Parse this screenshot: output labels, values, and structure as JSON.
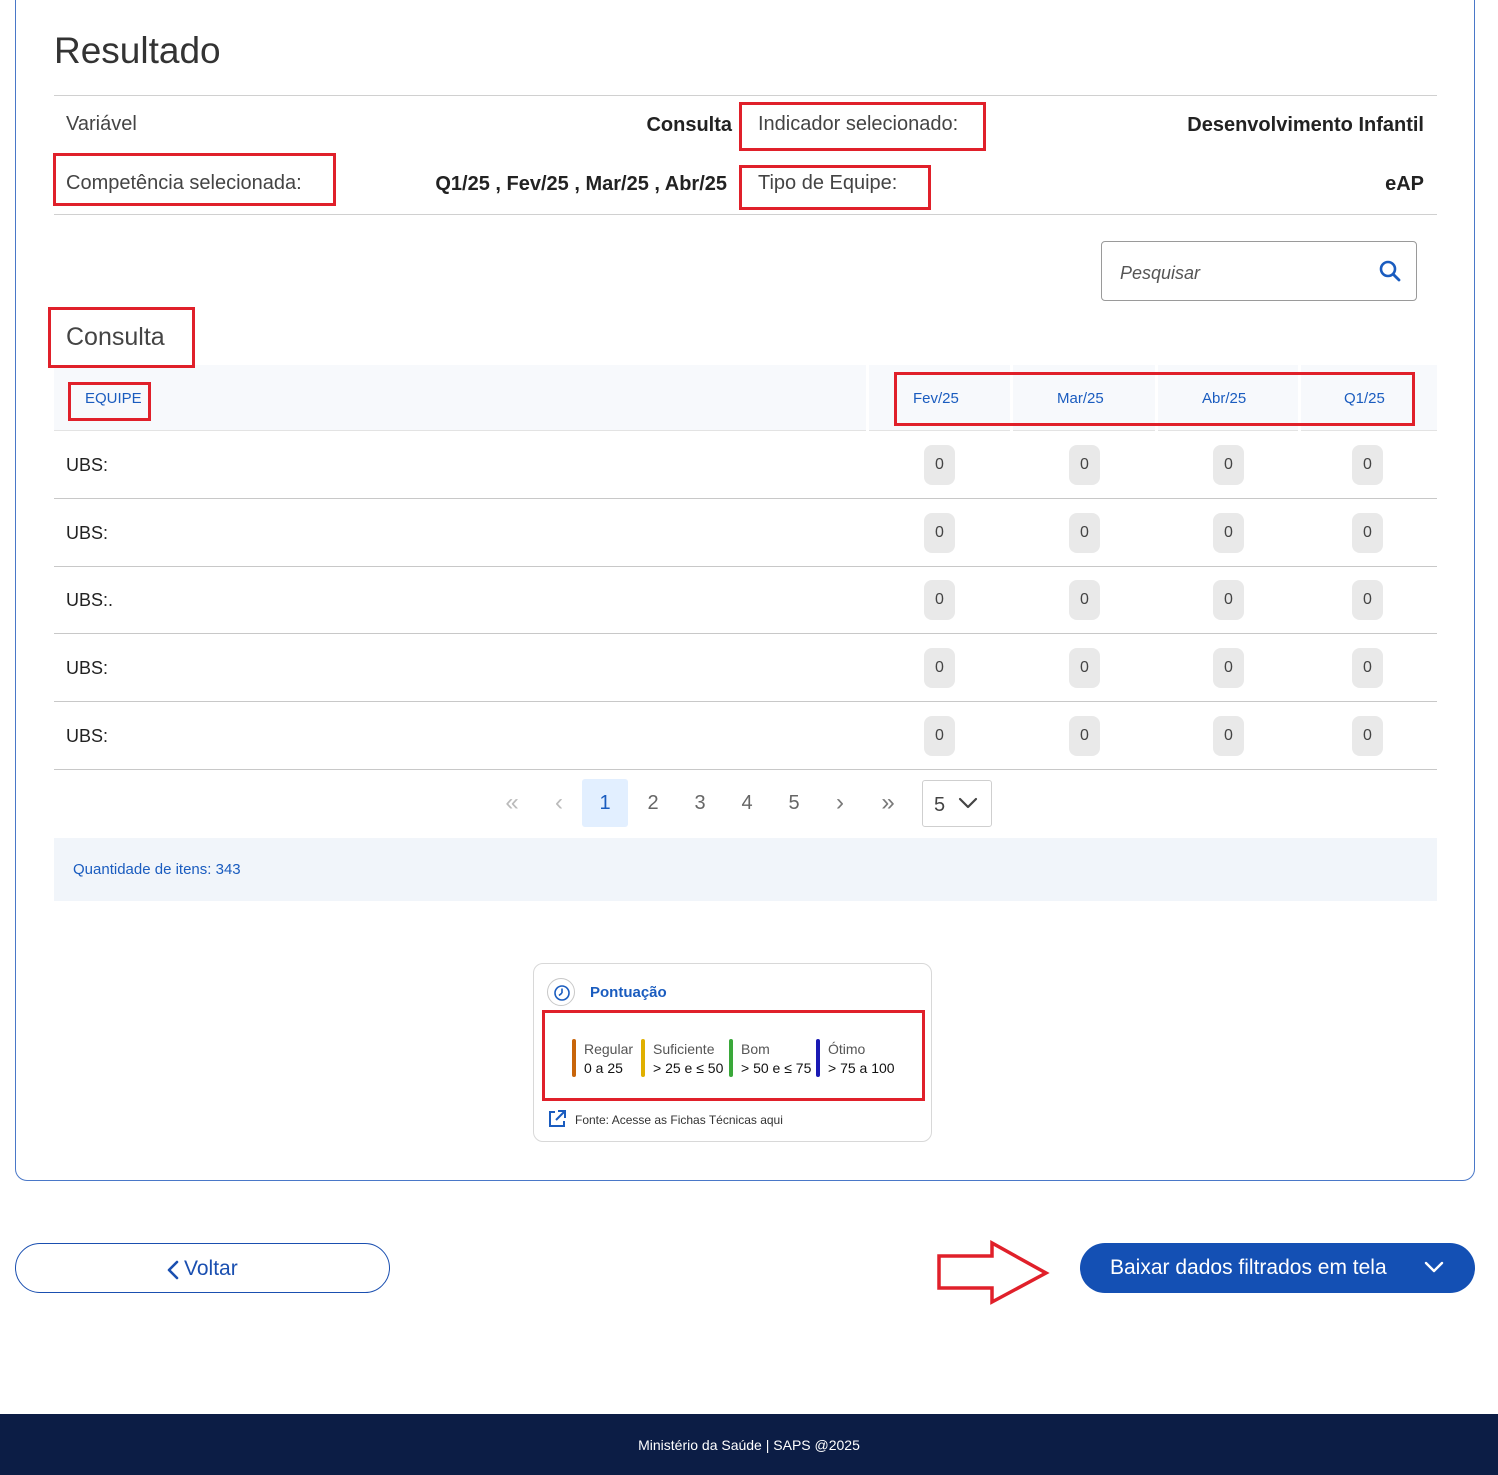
{
  "page": {
    "title": "Resultado"
  },
  "info": {
    "variavel_label": "Variável",
    "variavel_value": "Consulta",
    "indicador_label": "Indicador selecionado:",
    "indicador_value": "Desenvolvimento Infantil",
    "competencia_label": "Competência selecionada:",
    "competencia_value": "Q1/25 , Fev/25 , Mar/25 , Abr/25",
    "tipo_label": "Tipo de Equipe:",
    "tipo_value": "eAP"
  },
  "search": {
    "placeholder": "Pesquisar",
    "icon": "search-icon"
  },
  "table": {
    "section_title": "Consulta",
    "headers": {
      "equipe": "EQUIPE",
      "fev": "Fev/25",
      "mar": "Mar/25",
      "abr": "Abr/25",
      "q1": "Q1/25"
    },
    "rows": [
      {
        "label": "UBS:",
        "fev": "0",
        "mar": "0",
        "abr": "0",
        "q1": "0"
      },
      {
        "label": "UBS:",
        "fev": "0",
        "mar": "0",
        "abr": "0",
        "q1": "0"
      },
      {
        "label": "UBS:.",
        "fev": "0",
        "mar": "0",
        "abr": "0",
        "q1": "0"
      },
      {
        "label": "UBS:",
        "fev": "0",
        "mar": "0",
        "abr": "0",
        "q1": "0"
      },
      {
        "label": "UBS:",
        "fev": "0",
        "mar": "0",
        "abr": "0",
        "q1": "0"
      }
    ]
  },
  "pagination": {
    "first": "«",
    "prev": "‹",
    "pages": [
      "1",
      "2",
      "3",
      "4",
      "5"
    ],
    "current": "1",
    "next": "›",
    "last": "»",
    "page_size": "5"
  },
  "quantity": {
    "text": "Quantidade de itens: 343"
  },
  "legend": {
    "title": "Pontuação",
    "items": [
      {
        "name": "Regular",
        "range": "0 a 25",
        "color": "#c8650a"
      },
      {
        "name": "Suficiente",
        "range": "> 25 e ≤ 50",
        "color": "#e0b000"
      },
      {
        "name": "Bom",
        "range": "> 50 e ≤ 75",
        "color": "#3aa83a"
      },
      {
        "name": "Ótimo",
        "range": "> 75 a 100",
        "color": "#1a1ab4"
      }
    ],
    "source": "Fonte: Acesse as Fichas Técnicas aqui"
  },
  "actions": {
    "back_label": "Voltar",
    "download_label": "Baixar dados filtrados em tela"
  },
  "footer": {
    "text": "Ministério da Saúde | SAPS @2025"
  },
  "colors": {
    "accent": "#1a5cbf",
    "button": "#1450b4",
    "footer": "#0c1d45",
    "highlight": "#e0202a"
  }
}
